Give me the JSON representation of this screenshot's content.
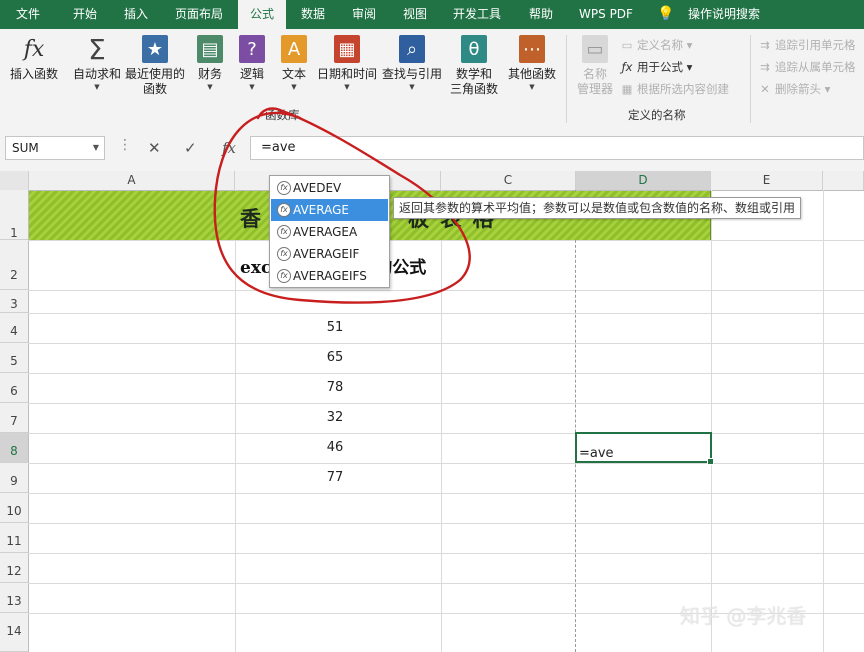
{
  "menu": {
    "tabs": [
      {
        "label": "文件"
      },
      {
        "label": "开始"
      },
      {
        "label": "插入"
      },
      {
        "label": "页面布局"
      },
      {
        "label": "公式"
      },
      {
        "label": "数据"
      },
      {
        "label": "审阅"
      },
      {
        "label": "视图"
      },
      {
        "label": "开发工具"
      },
      {
        "label": "帮助"
      },
      {
        "label": "WPS PDF"
      }
    ],
    "active_tab": "公式",
    "tell_me": "操作说明搜索"
  },
  "ribbon": {
    "insert_function": "插入函数",
    "autosum": "自动求和",
    "recent_line1": "最近使用的",
    "recent_line2": "函数",
    "financial": "财务",
    "logical": "逻辑",
    "text": "文本",
    "datetime": "日期和时间",
    "lookup": "查找与引用",
    "math_line1": "数学和",
    "math_line2": "三角函数",
    "other": "其他函数",
    "library_group": "函数库",
    "name_manager_line1": "名称",
    "name_manager_line2": "管理器",
    "define_name": "定义名称",
    "use_in_formula": "用于公式",
    "create_from_selection": "根据所选内容创建",
    "defined_names_group": "定义的名称",
    "trace_precedents": "追踪引用单元格",
    "trace_dependents": "追踪从属单元格",
    "remove_arrows": "删除箭头",
    "colors": {
      "fx_icon": "#333333",
      "sigma": "#444444",
      "book_blue": "#3a6ea5",
      "book_green": "#4d8a6a",
      "book_purple": "#7b4ea3",
      "book_orange": "#e39a2b",
      "book_red": "#c5442e",
      "book_navy": "#2f5f9e",
      "book_teal": "#2f8a85",
      "book_brown": "#c0612b"
    }
  },
  "formula_bar": {
    "name_box": "SUM",
    "formula": "=ave",
    "cancel_icon": "✕",
    "enter_icon": "✓",
    "fx_label": "fx"
  },
  "grid": {
    "columns": [
      "A",
      "B",
      "C",
      "D",
      "E"
    ],
    "rows": [
      "1",
      "2",
      "3",
      "4",
      "5",
      "6",
      "7",
      "8",
      "9",
      "10",
      "11",
      "12",
      "13",
      "14"
    ],
    "banner_text": "香",
    "banner_text_right": "板 表 格",
    "subtitle_left": "exc",
    "subtitle_right": "的公式",
    "values": [
      "51",
      "65",
      "78",
      "32",
      "46",
      "77"
    ],
    "active_cell_text": "=ave",
    "colors": {
      "accent": "#217346",
      "banner": "#a7d13d"
    }
  },
  "autocomplete": {
    "items": [
      "AVEDEV",
      "AVERAGE",
      "AVERAGEA",
      "AVERAGEIF",
      "AVERAGEIFS"
    ],
    "selected_index": 1,
    "tooltip": "返回其参数的算术平均值；参数可以是数值或包含数值的名称、数组或引用"
  },
  "watermark": "知乎 @李兆香"
}
